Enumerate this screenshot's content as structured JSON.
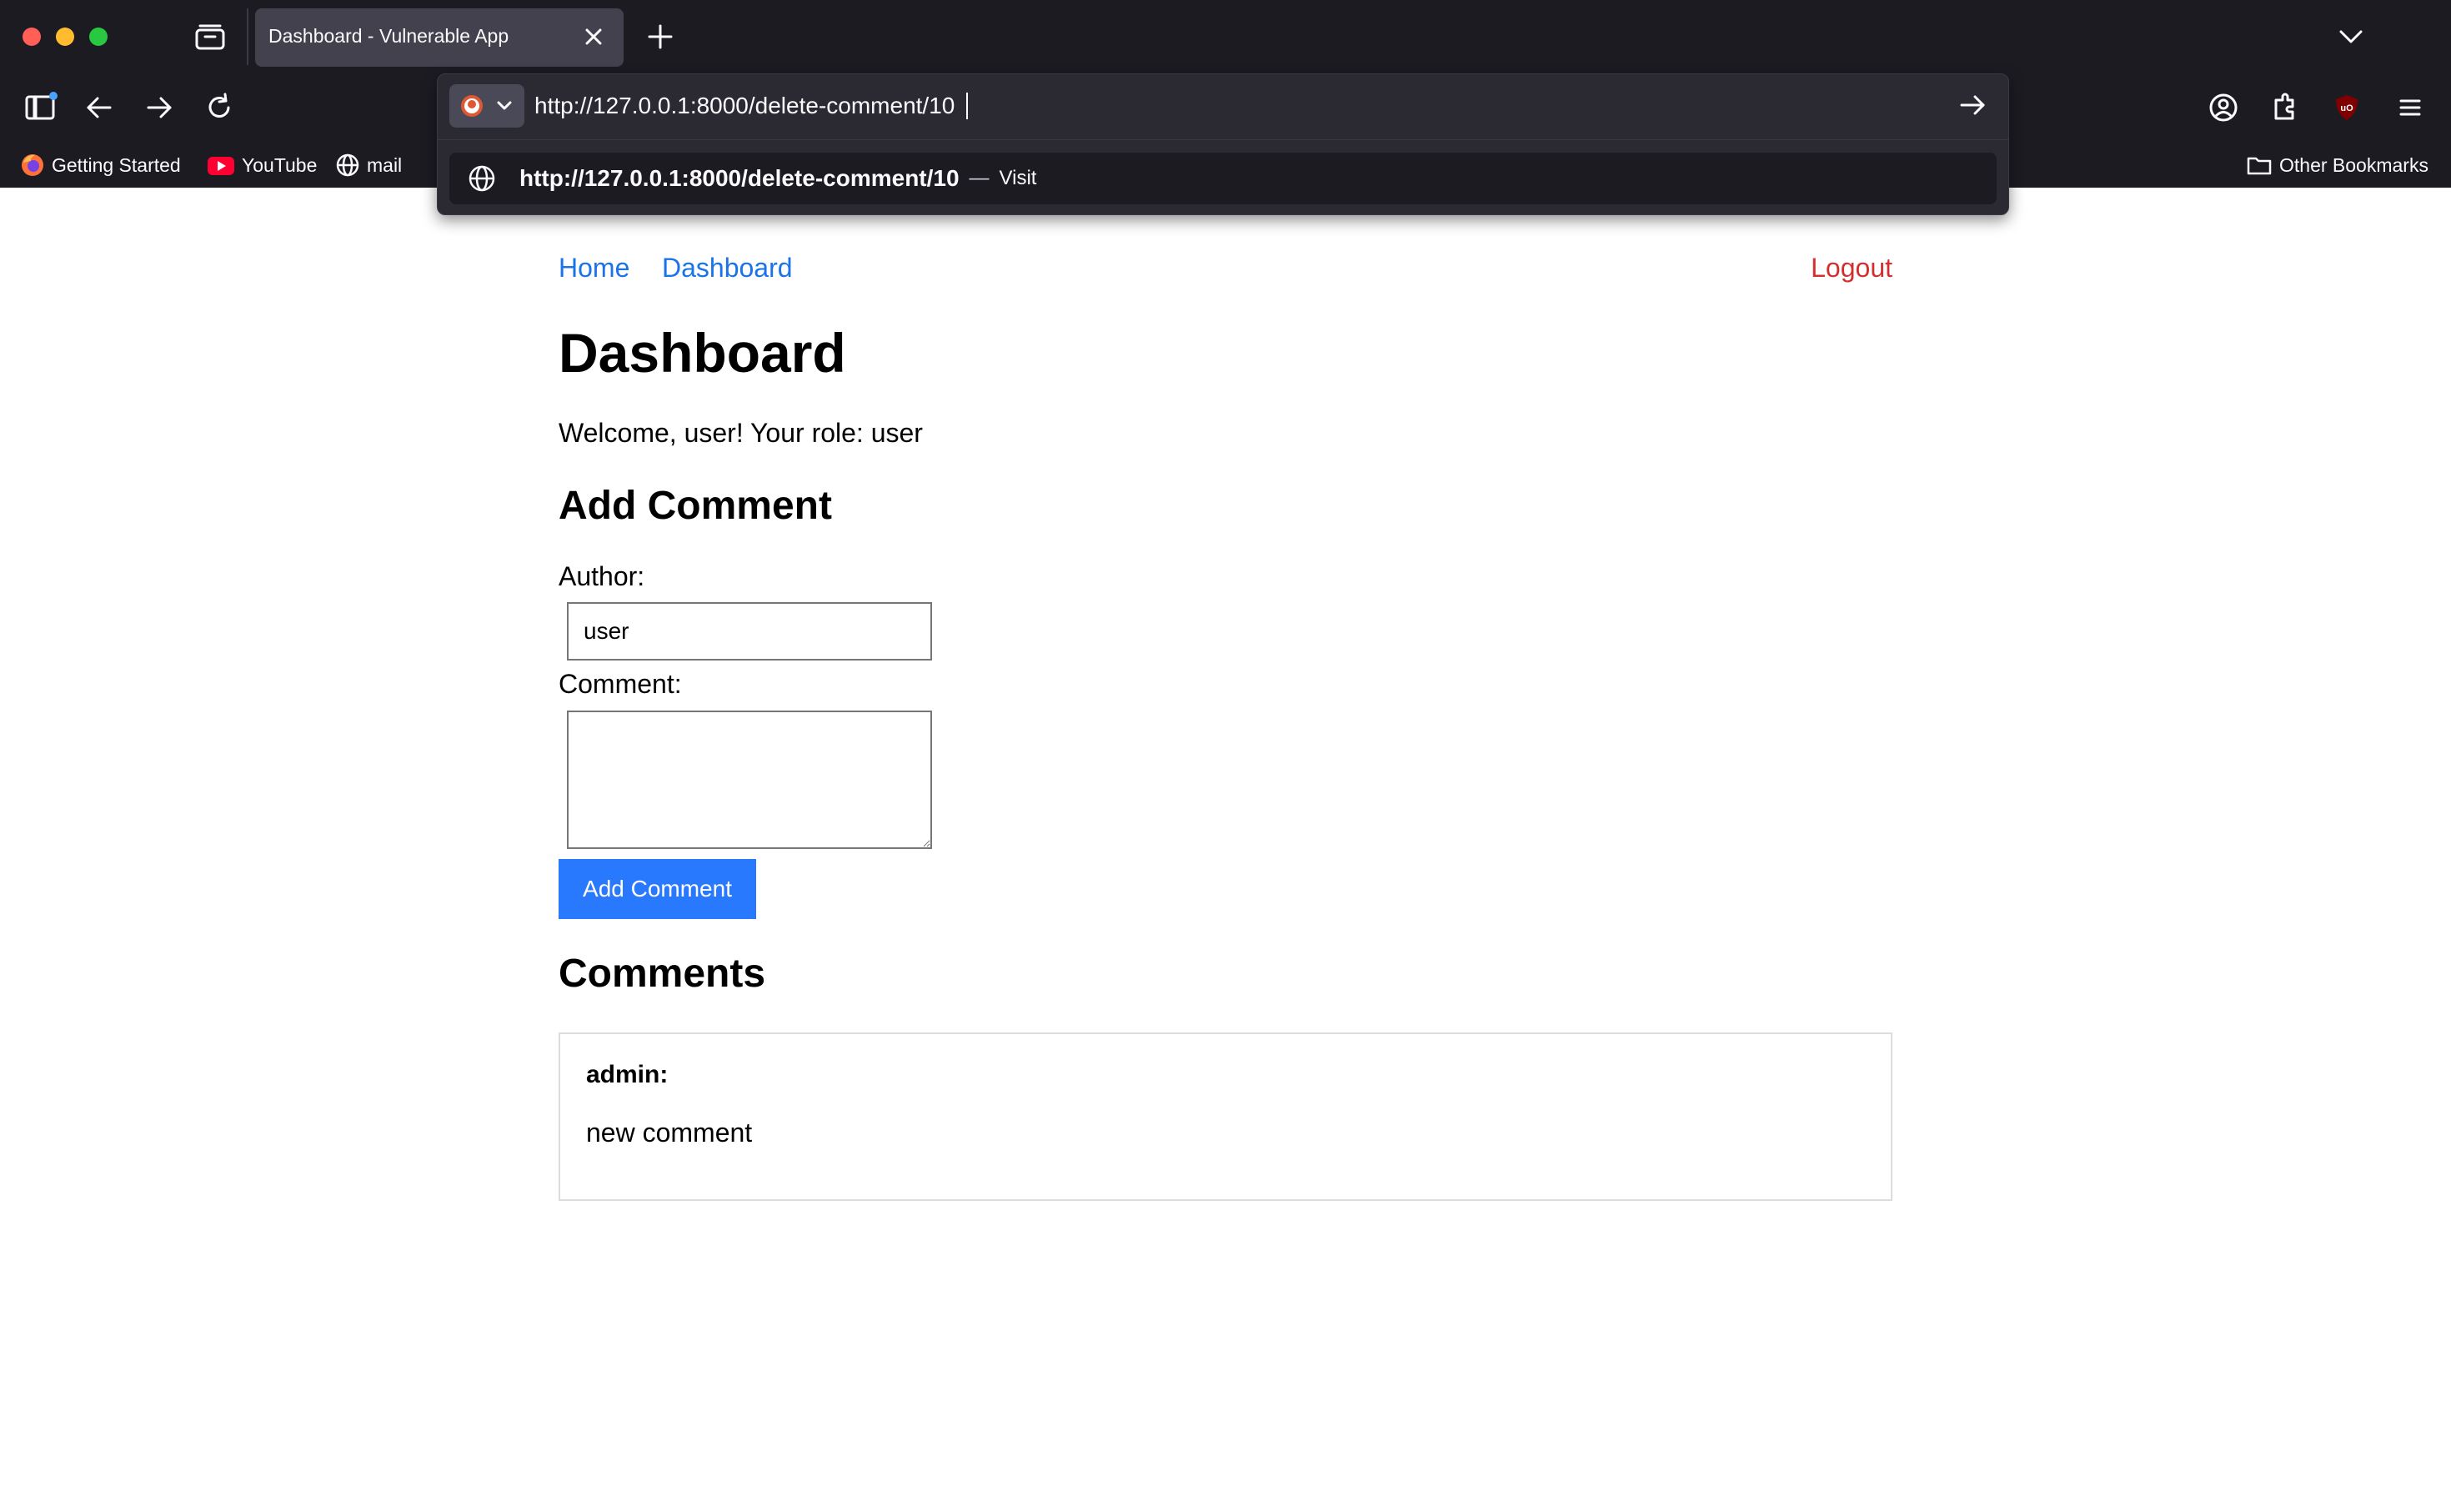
{
  "browser": {
    "tab_title": "Dashboard - Vulnerable App",
    "url_value": "http://127.0.0.1:8000/delete-comment/10",
    "suggestion": {
      "url": "http://127.0.0.1:8000/delete-comment/10",
      "separator": "—",
      "action": "Visit"
    },
    "bookmarks": [
      {
        "label": "Getting Started",
        "icon": "firefox-icon"
      },
      {
        "label": "YouTube",
        "icon": "youtube-icon"
      },
      {
        "label": "mail",
        "icon": "globe-icon"
      }
    ],
    "other_bookmarks": "Other Bookmarks"
  },
  "nav": {
    "home": "Home",
    "dashboard": "Dashboard",
    "logout": "Logout"
  },
  "page": {
    "title": "Dashboard",
    "welcome": "Welcome, user! Your role: user",
    "add_comment_heading": "Add Comment",
    "author_label": "Author:",
    "author_value": "user",
    "comment_label": "Comment:",
    "submit_label": "Add Comment",
    "comments_heading": "Comments"
  },
  "comments": [
    {
      "author": "admin:",
      "text": "new comment"
    }
  ],
  "colors": {
    "link": "#1a73e8",
    "logout": "#d32f2f",
    "button": "#2979ff",
    "chrome": "#1c1b22"
  }
}
